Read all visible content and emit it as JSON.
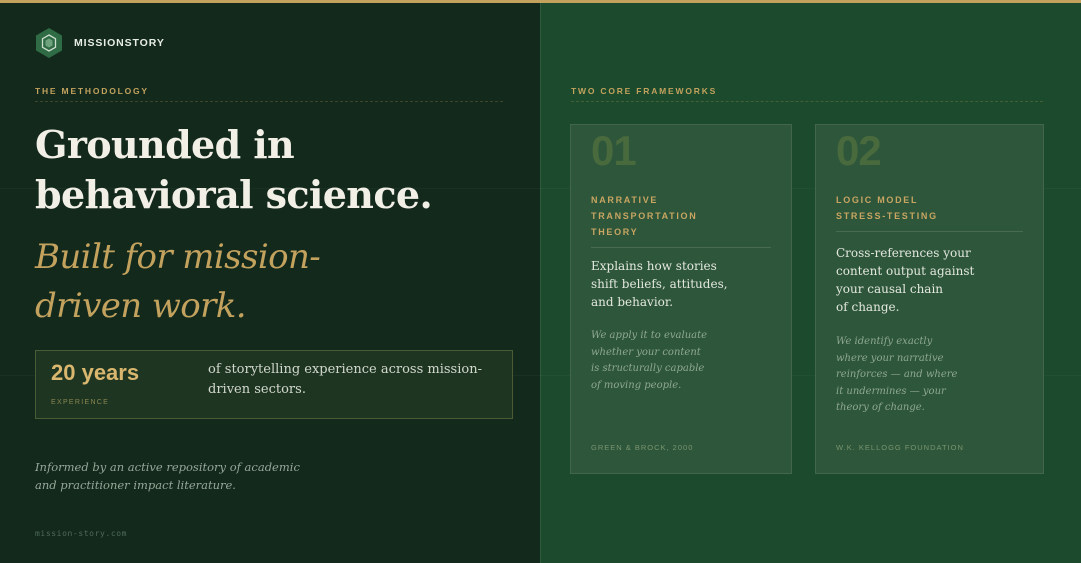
{
  "brand": {
    "name": "MISSIONSTORY",
    "site": "mission-story.com"
  },
  "left": {
    "eyebrow": "THE METHODOLOGY",
    "headline_line1": "Grounded in",
    "headline_line2": "behavioral science.",
    "subline_line1": "Built for mission-",
    "subline_line2": "driven work.",
    "stat": {
      "value": "20 years",
      "label": "EXPERIENCE",
      "text": "of storytelling experience across mission-driven sectors."
    },
    "footnote_line1": "Informed by an active repository of academic",
    "footnote_line2": "and practitioner impact literature."
  },
  "right": {
    "eyebrow": "TWO CORE FRAMEWORKS",
    "cards": [
      {
        "number": "01",
        "title_lines": [
          "NARRATIVE",
          "TRANSPORTATION",
          "THEORY"
        ],
        "body_lines": [
          "Explains how stories",
          "shift beliefs, attitudes,",
          "and behavior."
        ],
        "note_lines": [
          "We apply it to evaluate",
          "whether your content",
          "is structurally capable",
          "of moving people."
        ],
        "citation": "GREEN & BROCK, 2000"
      },
      {
        "number": "02",
        "title_lines": [
          "LOGIC MODEL",
          "STRESS-TESTING"
        ],
        "body_lines": [
          "Cross-references your",
          "content output against",
          "your causal chain",
          "of change."
        ],
        "note_lines": [
          "We identify exactly",
          "where your narrative",
          "reinforces — and where",
          "it undermines — your",
          "theory of change."
        ],
        "citation": "W.K. KELLOGG FOUNDATION"
      }
    ]
  },
  "colors": {
    "gold_accent": "#c3a25e",
    "left_bg": "#12291c",
    "right_bg": "#1b4a2c",
    "card_bg": "#2e563b"
  },
  "icons": {
    "logo": "hexagon-logo-icon"
  }
}
